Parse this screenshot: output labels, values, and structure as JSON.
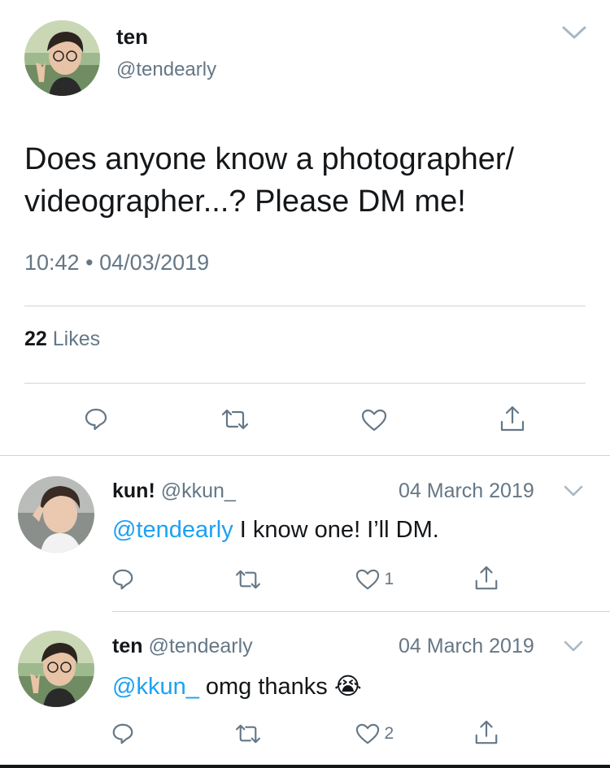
{
  "main_tweet": {
    "author_name": "ten",
    "author_handle": "@tendearly",
    "text_line1": "Does anyone know a photographer/",
    "text_line2": "videographer...? Please DM me!",
    "time": "10:42",
    "dot": "•",
    "date": "04/03/2019",
    "likes_count": "22",
    "likes_label": "Likes"
  },
  "replies": [
    {
      "author_name": "kun!",
      "author_handle": "@kkun_",
      "date": "04 March 2019",
      "mention": "@tendearly",
      "text": " I know one! I’ll DM.",
      "emoji": "",
      "like_count": "1"
    },
    {
      "author_name": "ten",
      "author_handle": "@tendearly",
      "date": "04 March 2019",
      "mention": "@kkun_",
      "text": " omg thanks ",
      "emoji": "😭",
      "like_count": "2"
    }
  ],
  "colors": {
    "text": "#14171a",
    "muted": "#657786",
    "link": "#1da1f2",
    "separator": "#cfd5da"
  },
  "icons": [
    "chevron-down-icon",
    "reply-icon",
    "retweet-icon",
    "like-icon",
    "share-icon"
  ]
}
